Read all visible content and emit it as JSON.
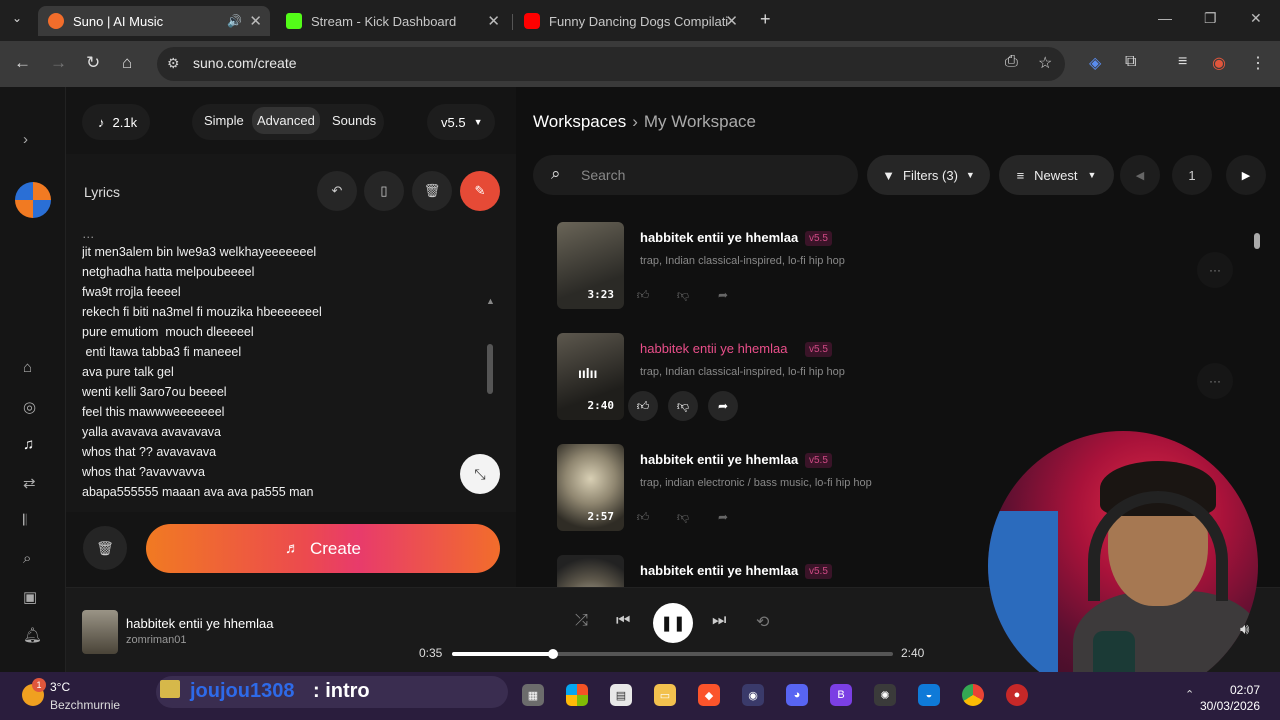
{
  "browser": {
    "tabs": [
      {
        "title": "Suno | AI Music",
        "active": true,
        "favicon_color": "#f26d2b",
        "audio": true
      },
      {
        "title": "Stream - Kick Dashboard",
        "active": false,
        "favicon_color": "#53fc18"
      },
      {
        "title": "Funny Dancing Dogs Compilati",
        "active": false,
        "favicon_color": "#ff0000"
      }
    ],
    "new_tab": "+",
    "url": "suno.com/create"
  },
  "app": {
    "credits": "2.1k",
    "modes": [
      "Simple",
      "Advanced",
      "Sounds"
    ],
    "active_mode": "Advanced",
    "version": "v5.5",
    "lyrics_label": "Lyrics",
    "lyrics_lines": [
      "jit men3alem bin lwe9a3 welkhayeeeeeeel",
      "netghadha hatta melpoubeeeel",
      "fwa9t rrojla feeeel",
      "rekech fi biti na3mel fi mouzika hbeeeeeeel",
      "pure emutiom  mouch dleeeeel",
      " enti ltawa tabba3 fi maneeel",
      "ava pure talk gel",
      "wenti kelli 3aro7ou beeeel",
      "feel this mawwweeeeeeel",
      "yalla avavava avavavava",
      "whos that ?? avavavava",
      "whos that ?avavvavva",
      "abapa555555 maaan ava ava pa555 man"
    ],
    "create_label": "Create",
    "accent_color": "#e64a36"
  },
  "workspace": {
    "breadcrumb_root": "Workspaces",
    "breadcrumb_current": "My Workspace",
    "search_placeholder": "Search",
    "filters_label": "Filters (3)",
    "sort_label": "Newest",
    "page": "1",
    "songs": [
      {
        "title": "habbitek entii ye hhemlaa",
        "version": "v5.5",
        "tags": "trap, Indian classical-inspired, lo-fi hip hop",
        "duration": "3:23",
        "playing": false
      },
      {
        "title": "habbitek entii ye hhemlaa",
        "version": "v5.5",
        "tags": "trap, Indian classical-inspired, lo-fi hip hop",
        "duration": "2:40",
        "playing": true
      },
      {
        "title": "habbitek entii ye hhemlaa",
        "version": "v5.5",
        "tags": "trap, indian electronic / bass music, lo-fi hip hop",
        "duration": "2:57",
        "playing": false
      },
      {
        "title": "habbitek entii ye hhemlaa",
        "version": "v5.5",
        "tags": "",
        "duration": "",
        "playing": false
      }
    ]
  },
  "player": {
    "title": "habbitek entii ye hhemlaa",
    "author": "zomriman01",
    "elapsed": "0:35",
    "total": "2:40",
    "progress": 0.23
  },
  "taskbar": {
    "temp": "3°C",
    "place": "Bezchmurnie",
    "weather_badge": "1",
    "chat_user": "joujou1308",
    "chat_message": ": intro",
    "time": "02:07",
    "date": "30/03/2026"
  }
}
